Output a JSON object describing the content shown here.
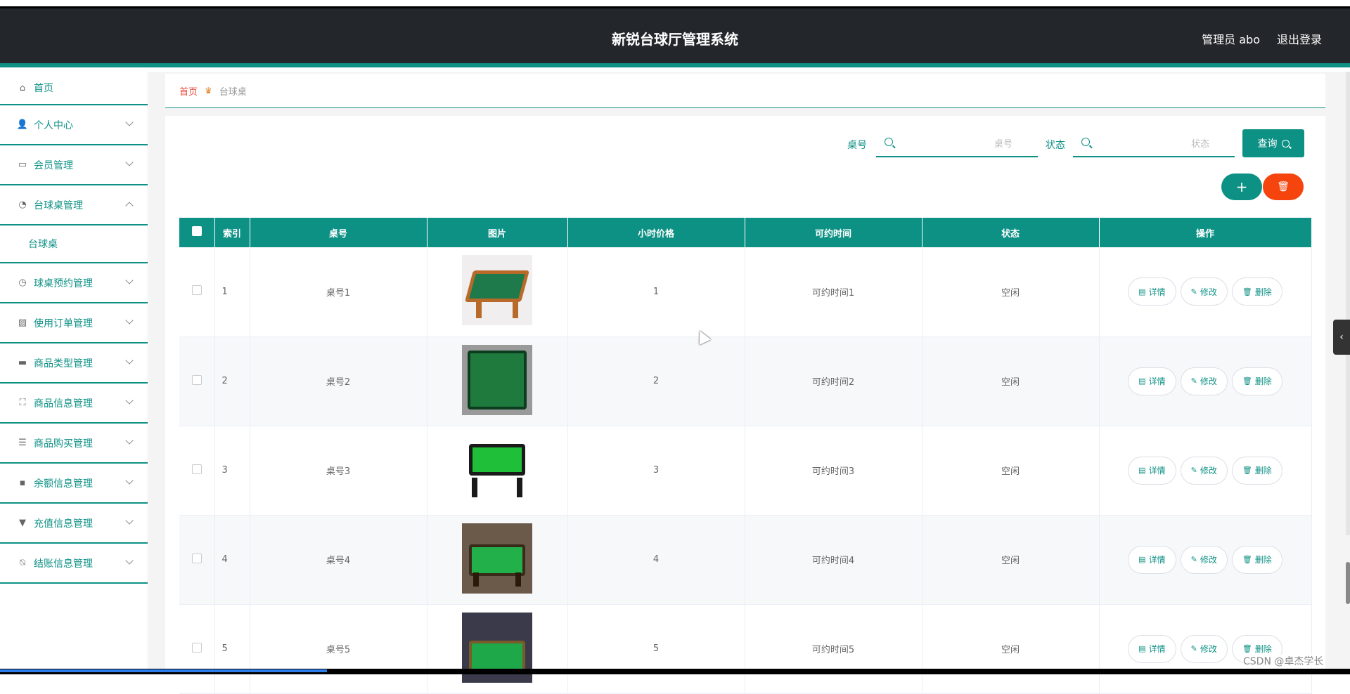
{
  "header": {
    "title": "新锐台球厅管理系统",
    "user": "管理员 abo",
    "logout": "退出登录"
  },
  "sidebar": {
    "items": [
      {
        "label": "首页",
        "icon": "home-icon"
      },
      {
        "label": "个人中心",
        "icon": "user-icon"
      },
      {
        "label": "会员管理",
        "icon": "chat-icon"
      },
      {
        "label": "台球桌管理",
        "icon": "dashboard-icon",
        "expanded": true
      },
      {
        "label": "球桌预约管理",
        "icon": "clock-icon"
      },
      {
        "label": "使用订单管理",
        "icon": "chart-icon"
      },
      {
        "label": "商品类型管理",
        "icon": "wallet-icon"
      },
      {
        "label": "商品信息管理",
        "icon": "fullscreen-icon"
      },
      {
        "label": "商品购买管理",
        "icon": "list-icon"
      },
      {
        "label": "余额信息管理",
        "icon": "message-icon"
      },
      {
        "label": "充值信息管理",
        "icon": "stamp-icon"
      },
      {
        "label": "结账信息管理",
        "icon": "bell-off-icon"
      }
    ],
    "submenu": {
      "label": "台球桌"
    }
  },
  "breadcrumb": {
    "home": "首页",
    "current": "台球桌"
  },
  "search": {
    "table_no_label": "桌号",
    "table_no_placeholder": "桌号",
    "status_label": "状态",
    "status_placeholder": "状态",
    "query_label": "查询"
  },
  "actions": {
    "add": "+",
    "delete_icon": "trash-icon"
  },
  "table": {
    "headers": [
      "索引",
      "桌号",
      "图片",
      "小时价格",
      "可约时间",
      "状态",
      "操作"
    ],
    "rows": [
      {
        "index": "1",
        "table_no": "桌号1",
        "price": "1",
        "time": "可约时间1",
        "status": "空闲"
      },
      {
        "index": "2",
        "table_no": "桌号2",
        "price": "2",
        "time": "可约时间2",
        "status": "空闲"
      },
      {
        "index": "3",
        "table_no": "桌号3",
        "price": "3",
        "time": "可约时间3",
        "status": "空闲"
      },
      {
        "index": "4",
        "table_no": "桌号4",
        "price": "4",
        "time": "可约时间4",
        "status": "空闲"
      },
      {
        "index": "5",
        "table_no": "桌号5",
        "price": "5",
        "time": "可约时间5",
        "status": "空闲"
      }
    ],
    "op_labels": {
      "detail": "详情",
      "edit": "修改",
      "delete": "删除"
    }
  },
  "watermark": "CSDN @卓杰学长",
  "colors": {
    "accent": "#0e9185",
    "danger": "#f5440e",
    "header": "#23272b"
  }
}
